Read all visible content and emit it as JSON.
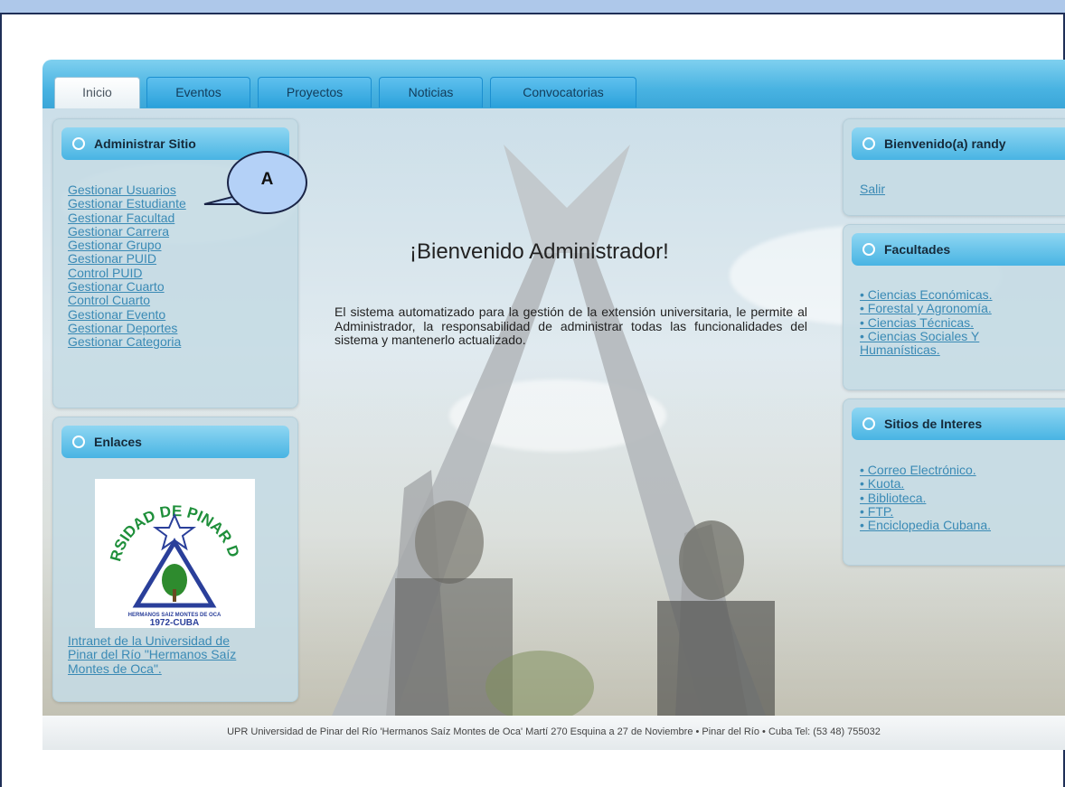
{
  "tabs": [
    "Inicio",
    "Eventos",
    "Proyectos",
    "Noticias",
    "Convocatorias"
  ],
  "admin": {
    "title": "Administrar Sitio",
    "links": [
      "Gestionar Usuarios",
      "Gestionar Estudiante",
      "Gestionar Facultad",
      "Gestionar Carrera",
      "Gestionar Grupo",
      "Gestionar PUID",
      "Control PUID",
      "Gestionar Cuarto",
      "Control Cuarto",
      "Gestionar Evento",
      "Gestionar Deportes",
      "Gestionar Categoria"
    ]
  },
  "enlaces": {
    "title": "Enlaces",
    "logo": {
      "top_text": "UNIVERSIDAD DE PINAR DEL RIO",
      "small": "HERMANOS SAIZ MONTES DE OCA",
      "year": "1972-CUBA"
    },
    "link_lines": [
      "Intranet de la Universidad de",
      "Pinar del Río \"Hermanos Saíz",
      "Montes de Oca\"."
    ]
  },
  "main": {
    "title": "¡Bienvenido Administrador!",
    "text": "El sistema automatizado para la gestión de la extensión universitaria, le permite al Administrador, la responsabilidad de administrar todas las funcionalidades del sistema y mantenerlo actualizado."
  },
  "welcome": {
    "title": "Bienvenido(a) randy",
    "logout": "Salir"
  },
  "facultades": {
    "title": "Facultades",
    "lines": [
      "• Ciencias Económicas.",
      "• Forestal y Agronomía.",
      "• Ciencias Técnicas.",
      "• Ciencias Sociales Y",
      "Humanísticas."
    ]
  },
  "sitios": {
    "title": "Sitios de Interes",
    "links": [
      "• Correo Electrónico.",
      "• Kuota.",
      "• Biblioteca.",
      "• FTP.",
      "• Enciclopedia Cubana."
    ]
  },
  "footer": "UPR Universidad de Pinar del Río 'Hermanos Saíz Montes de Oca' Martí 270 Esquina a 27 de Noviembre • Pinar del Río • Cuba Tel: (53 48) 755032",
  "callout_label": "A",
  "colors": {
    "tab_blue": "#2aa1db",
    "link": "#3a8ab5",
    "panel": "#c5dbe4"
  }
}
